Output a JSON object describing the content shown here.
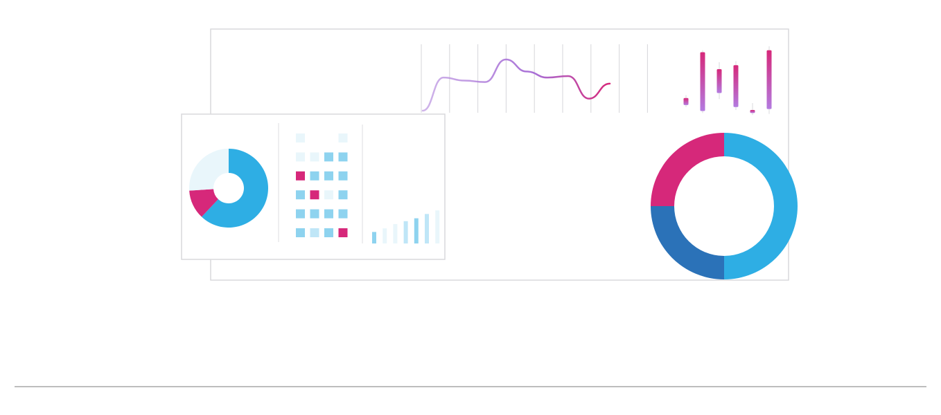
{
  "colors": {
    "background": "#ffffff",
    "panel_border": "#d9d9dc",
    "gridline": "#d9d9dc",
    "accent_blue": "#2eaee4",
    "accent_dark_blue": "#2b72b8",
    "accent_pink": "#d6287a",
    "accent_purple": "#a86fd6",
    "pale_blue": "#e9f6fb",
    "light_blue": "#bfe6f7",
    "mid_blue": "#8ed3ef",
    "divider": "#bdbdbd"
  },
  "illustration": {
    "back_panel": {
      "wave_line": {
        "points": [
          0,
          2.2,
          2.0,
          1.9,
          3.4,
          2.6,
          2.2,
          2.3,
          0.8,
          1.8
        ],
        "gradient_from": "#b083dc",
        "gradient_to": "#d6287a"
      },
      "candles": [
        {
          "low": 1.2,
          "high": 2.4,
          "open": 1.4,
          "close": 2.1
        },
        {
          "low": 0.6,
          "high": 6.9,
          "open": 0.8,
          "close": 6.7
        },
        {
          "low": 2.0,
          "high": 5.7,
          "open": 2.6,
          "close": 5.0
        },
        {
          "low": 0.9,
          "high": 5.8,
          "open": 1.2,
          "close": 5.4
        },
        {
          "low": 0.4,
          "high": 1.6,
          "open": 0.6,
          "close": 0.9
        },
        {
          "low": 0.5,
          "high": 7.3,
          "open": 1.0,
          "close": 6.9
        }
      ],
      "big_donut": [
        {
          "name": "segment-blue",
          "value": 50,
          "color": "#2eaee4"
        },
        {
          "name": "segment-dark-blue",
          "value": 25,
          "color": "#2b72b8"
        },
        {
          "name": "segment-pink",
          "value": 25,
          "color": "#d6287a"
        }
      ]
    },
    "front_panel": {
      "small_donut": [
        {
          "name": "segment-blue",
          "value": 62,
          "color": "#2eaee4"
        },
        {
          "name": "segment-pink",
          "value": 12,
          "color": "#d6287a"
        },
        {
          "name": "segment-pale",
          "value": 26,
          "color": "#e9f6fb"
        }
      ],
      "tile_grid": [
        [
          "pale",
          "empty",
          "empty",
          "pale"
        ],
        [
          "pale",
          "pale",
          "mid",
          "mid"
        ],
        [
          "pink",
          "mid",
          "mid",
          "mid"
        ],
        [
          "mid",
          "pink",
          "pale",
          "mid"
        ],
        [
          "mid",
          "mid",
          "mid",
          "mid"
        ],
        [
          "mid",
          "light",
          "mid",
          "pink"
        ]
      ],
      "small_bars": [
        {
          "value": 1.6,
          "tone": "mid"
        },
        {
          "value": 2.1,
          "tone": "pale"
        },
        {
          "value": 2.7,
          "tone": "pale"
        },
        {
          "value": 3.1,
          "tone": "light"
        },
        {
          "value": 3.5,
          "tone": "mid"
        },
        {
          "value": 4.1,
          "tone": "light"
        },
        {
          "value": 4.6,
          "tone": "pale"
        }
      ]
    }
  }
}
